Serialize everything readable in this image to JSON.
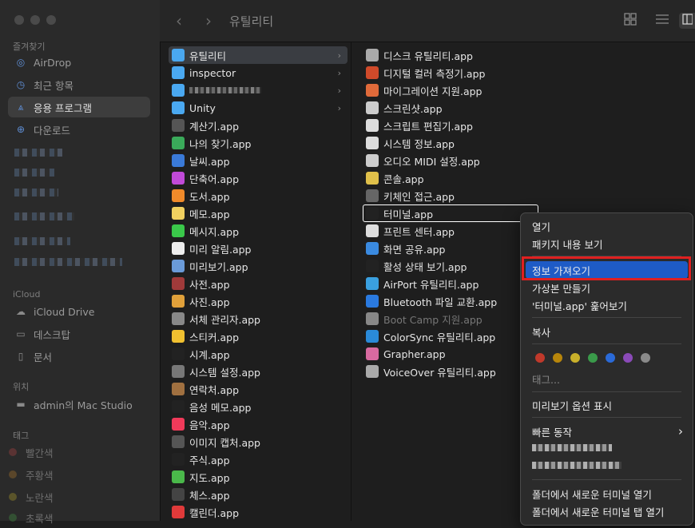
{
  "toolbar": {
    "title": "유틸리티",
    "back": "‹",
    "forward": "›"
  },
  "sidebar": {
    "favorites_header": "즐겨찾기",
    "favorites": [
      {
        "label": "AirDrop",
        "icon": "airdrop-icon",
        "glyph": "◎"
      },
      {
        "label": "최근 항목",
        "icon": "clock-icon",
        "glyph": "◷"
      },
      {
        "label": "응용 프로그램",
        "icon": "apps-icon",
        "glyph": "⩓"
      },
      {
        "label": "다운로드",
        "icon": "download-icon",
        "glyph": "⊕"
      }
    ],
    "icloud_header": "iCloud",
    "icloud": [
      {
        "label": "iCloud Drive",
        "icon": "cloud-icon",
        "glyph": "☁"
      },
      {
        "label": "데스크탑",
        "icon": "desktop-icon",
        "glyph": "▭"
      },
      {
        "label": "문서",
        "icon": "document-icon",
        "glyph": "▯"
      }
    ],
    "locations_header": "위치",
    "locations": [
      {
        "label": "admin의 Mac Studio",
        "icon": "computer-icon",
        "glyph": "▬"
      }
    ],
    "tags_header": "태그",
    "tags": [
      {
        "label": "빨간색",
        "color": "#7a3a3a"
      },
      {
        "label": "주황색",
        "color": "#7a5a2a"
      },
      {
        "label": "노란색",
        "color": "#7a702a"
      },
      {
        "label": "초록색",
        "color": "#3a6a3a"
      }
    ]
  },
  "column1": [
    {
      "label": "유틸리티",
      "kind": "folder",
      "chevron": "›",
      "icon_color": "#4aa8f0"
    },
    {
      "label": "inspector",
      "kind": "folder",
      "chevron": "›",
      "icon_color": "#4aa8f0"
    },
    {
      "label": "",
      "kind": "folder",
      "chevron": "›",
      "icon_color": "#4aa8f0"
    },
    {
      "label": "Unity",
      "kind": "folder",
      "chevron": "›",
      "icon_color": "#4aa8f0"
    },
    {
      "label": "계산기.app",
      "icon_color": "#555555"
    },
    {
      "label": "나의 찾기.app",
      "icon_color": "#3aaa5a"
    },
    {
      "label": "날씨.app",
      "icon_color": "#3a7ad8"
    },
    {
      "label": "단축어.app",
      "icon_color": "#c04ad8"
    },
    {
      "label": "도서.app",
      "icon_color": "#f08a2a"
    },
    {
      "label": "메모.app",
      "icon_color": "#f0d060"
    },
    {
      "label": "메시지.app",
      "icon_color": "#3ac84a"
    },
    {
      "label": "미리 알림.app",
      "icon_color": "#eeeeee"
    },
    {
      "label": "미리보기.app",
      "icon_color": "#6a9ad8"
    },
    {
      "label": "사전.app",
      "icon_color": "#a03a3a"
    },
    {
      "label": "사진.app",
      "icon_color": "#e0a03a"
    },
    {
      "label": "서체 관리자.app",
      "icon_color": "#888888"
    },
    {
      "label": "스티커.app",
      "icon_color": "#f0c030"
    },
    {
      "label": "시계.app",
      "icon_color": "#222222"
    },
    {
      "label": "시스템 설정.app",
      "icon_color": "#777777"
    },
    {
      "label": "연락처.app",
      "icon_color": "#a07040"
    },
    {
      "label": "음성 메모.app",
      "icon_color": "#222222"
    },
    {
      "label": "음악.app",
      "icon_color": "#f03a5a"
    },
    {
      "label": "이미지 캡처.app",
      "icon_color": "#555555"
    },
    {
      "label": "주식.app",
      "icon_color": "#222222"
    },
    {
      "label": "지도.app",
      "icon_color": "#4ab84a"
    },
    {
      "label": "체스.app",
      "icon_color": "#444444"
    },
    {
      "label": "캘린더.app",
      "icon_color": "#e03a3a"
    }
  ],
  "column2": [
    {
      "label": "디스크 유틸리티.app",
      "icon_color": "#aaaaaa"
    },
    {
      "label": "디지털 컬러 측정기.app",
      "icon_color": "#d04a2a"
    },
    {
      "label": "마이그레이션 지원.app",
      "icon_color": "#e06a3a"
    },
    {
      "label": "스크린샷.app",
      "icon_color": "#cccccc"
    },
    {
      "label": "스크립트 편집기.app",
      "icon_color": "#dddddd"
    },
    {
      "label": "시스템 정보.app",
      "icon_color": "#dddddd"
    },
    {
      "label": "오디오 MIDI 설정.app",
      "icon_color": "#cccccc"
    },
    {
      "label": "콘솔.app",
      "icon_color": "#e0c04a"
    },
    {
      "label": "키체인 접근.app",
      "icon_color": "#666666"
    },
    {
      "label": "터미널.app",
      "icon_color": "#222222"
    },
    {
      "label": "프린트 센터.app",
      "icon_color": "#dddddd"
    },
    {
      "label": "화면 공유.app",
      "icon_color": "#3a8ae0"
    },
    {
      "label": "활성 상태 보기.app",
      "icon_color": "#222222"
    },
    {
      "label": "AirPort 유틸리티.app",
      "icon_color": "#3aa0e0"
    },
    {
      "label": "Bluetooth 파일 교환.app",
      "icon_color": "#2a7ae0"
    },
    {
      "label": "Boot Camp 지원.app",
      "icon_color": "#888888",
      "dim": true
    },
    {
      "label": "ColorSync 유틸리티.app",
      "icon_color": "#2a8ad8"
    },
    {
      "label": "Grapher.app",
      "icon_color": "#d86aa0"
    },
    {
      "label": "VoiceOver 유틸리티.app",
      "icon_color": "#aaaaaa"
    }
  ],
  "context_menu": {
    "open": "열기",
    "show_package": "패키지 내용 보기",
    "get_info": "정보 가져오기",
    "make_alias": "가상본 만들기",
    "quick_look": "'터미널.app' 훑어보기",
    "copy": "복사",
    "tags_label": "태그...",
    "tag_colors": [
      "#c0392b",
      "#b8860b",
      "#c9b02a",
      "#3a9a4a",
      "#2a6ad8",
      "#8a4ab8",
      "#8a8a8a"
    ],
    "show_preview_options": "미리보기 옵션 표시",
    "quick_actions": "빠른 동작",
    "submenu_arrow": "›",
    "new_terminal_at_folder": "폴더에서 새로운 터미널 열기",
    "new_terminal_tab_at_folder": "폴더에서 새로운 터미널 탭 열기"
  }
}
